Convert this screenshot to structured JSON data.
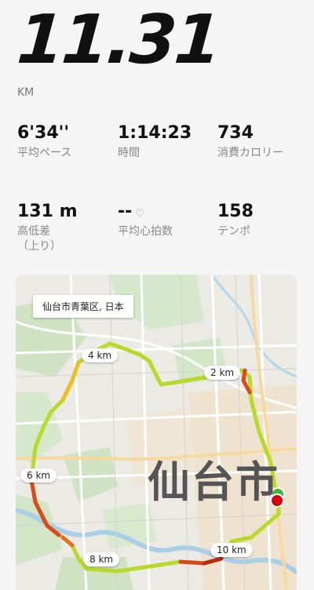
{
  "summary": {
    "distance": "11.31",
    "unit": "KM"
  },
  "stats": [
    {
      "value": "6'34''",
      "label": "平均ペース"
    },
    {
      "value": "1:14:23",
      "label": "時間"
    },
    {
      "value": "734",
      "label": "消費カロリー"
    },
    {
      "value": "131 m",
      "label": "高低差\n（上り）"
    },
    {
      "value": "--",
      "label": "平均心拍数",
      "icon": "heart-outline-icon"
    },
    {
      "value": "158",
      "label": "テンポ"
    }
  ],
  "map": {
    "location_label": "仙台市青葉区, 日本",
    "city_label": "仙台市",
    "km_markers": [
      "2 km",
      "4 km",
      "6 km",
      "8 km",
      "10 km"
    ],
    "colors": {
      "route_slow": "#d94a1a",
      "route_mid": "#e8c020",
      "route_fast": "#b8d82a",
      "end_marker": "#d40010",
      "start_marker": "#3fb43f"
    }
  }
}
